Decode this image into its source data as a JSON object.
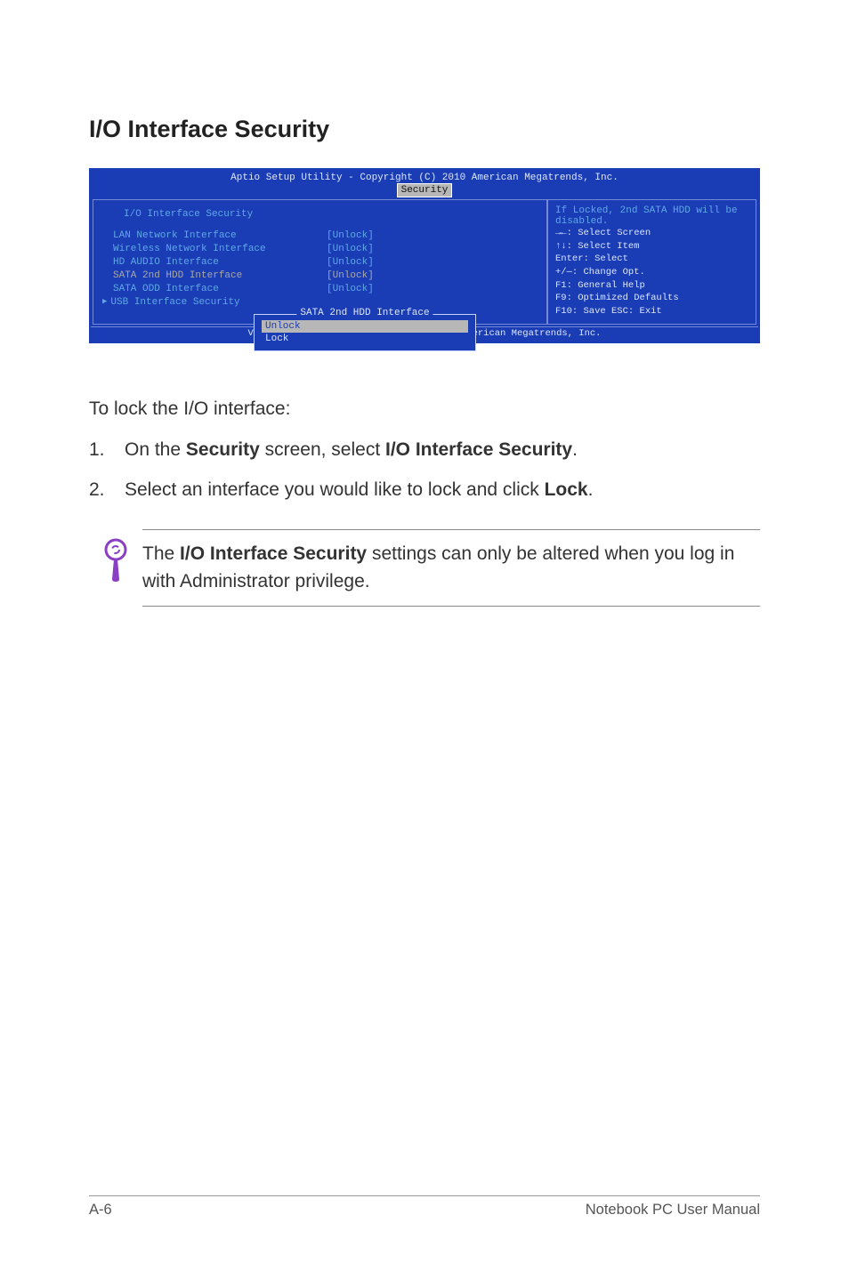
{
  "heading": "I/O Interface Security",
  "bios": {
    "title": "Aptio Setup Utility - Copyright (C) 2010 American Megatrends, Inc.",
    "tab": "Security",
    "left": {
      "section_title": "I/O Interface Security",
      "rows": [
        {
          "label": "LAN Network Interface",
          "value": "[Unlock]",
          "selected": false,
          "submenu": false
        },
        {
          "label": "Wireless Network Interface",
          "value": "[Unlock]",
          "selected": false,
          "submenu": false
        },
        {
          "label": "HD AUDIO Interface",
          "value": "[Unlock]",
          "selected": false,
          "submenu": false
        },
        {
          "label": "SATA 2nd HDD Interface",
          "value": "[Unlock]",
          "selected": true,
          "submenu": false
        },
        {
          "label": "SATA ODD Interface",
          "value": "[Unlock]",
          "selected": false,
          "submenu": false
        },
        {
          "label": "USB Interface Security",
          "value": "",
          "selected": false,
          "submenu": true
        }
      ],
      "popup": {
        "title": "SATA 2nd HDD Interface",
        "items": [
          {
            "text": "Unlock",
            "highlight": true
          },
          {
            "text": "Lock",
            "highlight": false
          }
        ]
      }
    },
    "right": {
      "help": "If Locked, 2nd SATA HDD will be disabled.",
      "keys": [
        "→←:   Select Screen",
        "↑↓:   Select Item",
        "Enter: Select",
        "+/—:  Change Opt.",
        "F1:    General Help",
        "F9:    Optimized Defaults",
        "F10:   Save   ESC: Exit"
      ]
    },
    "footer": "Version 2.01.1208. Copyright (C) 2010 American Megatrends, Inc."
  },
  "instructions": {
    "intro": "To lock the I/O interface:",
    "steps": [
      {
        "num": "1.",
        "prefix": "On the ",
        "bold1": "Security",
        "mid": " screen, select ",
        "bold2": "I/O Interface Security",
        "suffix": "."
      },
      {
        "num": "2.",
        "prefix": "Select an interface you would like to lock and click ",
        "bold1": "Lock",
        "mid": "",
        "bold2": "",
        "suffix": "."
      }
    ]
  },
  "note": {
    "prefix": "The ",
    "bold": "I/O Interface Security",
    "suffix": " settings can only be altered when you log in with Administrator privilege."
  },
  "footer": {
    "left": "A-6",
    "right": "Notebook PC User Manual"
  }
}
